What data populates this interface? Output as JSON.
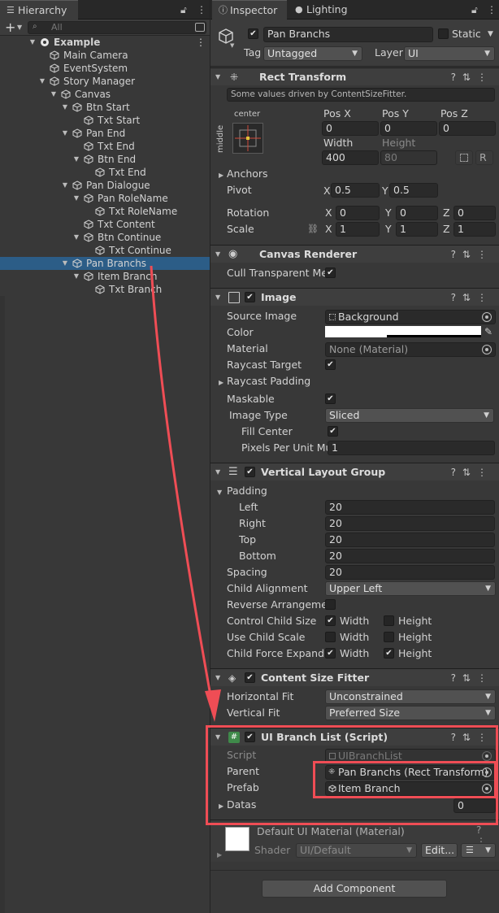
{
  "hierarchy": {
    "tab_label": "Hierarchy",
    "search_placeholder": "All",
    "add_label": "+",
    "rows": [
      {
        "label": "Example",
        "depth": 0,
        "expanded": true,
        "scene": true,
        "selected": false
      },
      {
        "label": "Main Camera",
        "depth": 1,
        "expanded": null,
        "selected": false
      },
      {
        "label": "EventSystem",
        "depth": 1,
        "expanded": null,
        "selected": false
      },
      {
        "label": "Story Manager",
        "depth": 1,
        "expanded": true,
        "selected": false
      },
      {
        "label": "Canvas",
        "depth": 2,
        "expanded": true,
        "selected": false
      },
      {
        "label": "Btn Start",
        "depth": 3,
        "expanded": true,
        "selected": false
      },
      {
        "label": "Txt Start",
        "depth": 4,
        "expanded": null,
        "selected": false
      },
      {
        "label": "Pan End",
        "depth": 3,
        "expanded": true,
        "selected": false
      },
      {
        "label": "Txt End",
        "depth": 4,
        "expanded": null,
        "selected": false
      },
      {
        "label": "Btn End",
        "depth": 4,
        "expanded": true,
        "selected": false
      },
      {
        "label": "Txt End",
        "depth": 5,
        "expanded": null,
        "selected": false
      },
      {
        "label": "Pan Dialogue",
        "depth": 3,
        "expanded": true,
        "selected": false
      },
      {
        "label": "Pan RoleName",
        "depth": 4,
        "expanded": true,
        "selected": false
      },
      {
        "label": "Txt RoleName",
        "depth": 5,
        "expanded": null,
        "selected": false
      },
      {
        "label": "Txt Content",
        "depth": 4,
        "expanded": null,
        "selected": false
      },
      {
        "label": "Btn Continue",
        "depth": 4,
        "expanded": true,
        "selected": false
      },
      {
        "label": "Txt Continue",
        "depth": 5,
        "expanded": null,
        "selected": false
      },
      {
        "label": "Pan Branchs",
        "depth": 3,
        "expanded": true,
        "selected": true
      },
      {
        "label": "Item Branch",
        "depth": 4,
        "expanded": true,
        "selected": false
      },
      {
        "label": "Txt Branch",
        "depth": 5,
        "expanded": null,
        "selected": false
      }
    ]
  },
  "inspector": {
    "tabs": [
      {
        "label": "Inspector",
        "active": true
      },
      {
        "label": "Lighting",
        "active": false
      }
    ],
    "object": {
      "name": "Pan Branchs",
      "active": true,
      "static_label": "Static",
      "tag_label": "Tag",
      "tag_value": "Untagged",
      "layer_label": "Layer",
      "layer_value": "UI"
    },
    "rect_transform": {
      "title": "Rect Transform",
      "notice": "Some values driven by ContentSizeFitter.",
      "anchor_h": "center",
      "anchor_v": "middle",
      "posx_label": "Pos X",
      "posx": "0",
      "posy_label": "Pos Y",
      "posy": "0",
      "posz_label": "Pos Z",
      "posz": "0",
      "width_label": "Width",
      "width": "400",
      "height_label": "Height",
      "height": "80",
      "r_button": "R",
      "anchors_label": "Anchors",
      "pivot_label": "Pivot",
      "pivot_x": "0.5",
      "pivot_y": "0.5",
      "rotation_label": "Rotation",
      "rot_x": "0",
      "rot_y": "0",
      "rot_z": "0",
      "scale_label": "Scale",
      "scale_x": "1",
      "scale_y": "1",
      "scale_z": "1",
      "x": "X",
      "y": "Y",
      "z": "Z"
    },
    "canvas_renderer": {
      "title": "Canvas Renderer",
      "cull_label": "Cull Transparent Mes",
      "cull_value": true
    },
    "image": {
      "title": "Image",
      "source_label": "Source Image",
      "source_value": "Background",
      "color_label": "Color",
      "color_value": "#ffffff",
      "material_label": "Material",
      "material_value": "None (Material)",
      "raycast_target_label": "Raycast Target",
      "raycast_target": true,
      "raycast_padding_label": "Raycast Padding",
      "maskable_label": "Maskable",
      "maskable": true,
      "image_type_label": "Image Type",
      "image_type": "Sliced",
      "fill_center_label": "Fill Center",
      "fill_center": true,
      "ppu_label": "Pixels Per Unit Mul",
      "ppu_value": "1"
    },
    "vlg": {
      "title": "Vertical Layout Group",
      "padding_label": "Padding",
      "left_label": "Left",
      "left": "20",
      "right_label": "Right",
      "right": "20",
      "top_label": "Top",
      "top": "20",
      "bottom_label": "Bottom",
      "bottom": "20",
      "spacing_label": "Spacing",
      "spacing": "20",
      "align_label": "Child Alignment",
      "align": "Upper Left",
      "reverse_label": "Reverse Arrangemen",
      "ccs_label": "Control Child Size",
      "ucs_label": "Use Child Scale",
      "cfe_label": "Child Force Expand",
      "width_label": "Width",
      "height_label": "Height",
      "ccs_w": true,
      "ccs_h": false,
      "ucs_w": false,
      "ucs_h": false,
      "cfe_w": true,
      "cfe_h": true
    },
    "csf": {
      "title": "Content Size Fitter",
      "hfit_label": "Horizontal Fit",
      "hfit": "Unconstrained",
      "vfit_label": "Vertical Fit",
      "vfit": "Preferred Size"
    },
    "branch_list": {
      "title": "UI Branch List (Script)",
      "script_label": "Script",
      "script_value": "UIBranchList",
      "parent_label": "Parent",
      "parent_value": "Pan Branchs (Rect Transform)",
      "prefab_label": "Prefab",
      "prefab_value": "Item Branch",
      "datas_label": "Datas",
      "datas_value": "0"
    },
    "material": {
      "title": "Default UI Material (Material)",
      "shader_label": "Shader",
      "shader_value": "UI/Default",
      "edit_label": "Edit..."
    },
    "add_component": "Add Component"
  },
  "colors": {
    "accent_red": "#ef4d55",
    "selection": "#2c5d87"
  }
}
